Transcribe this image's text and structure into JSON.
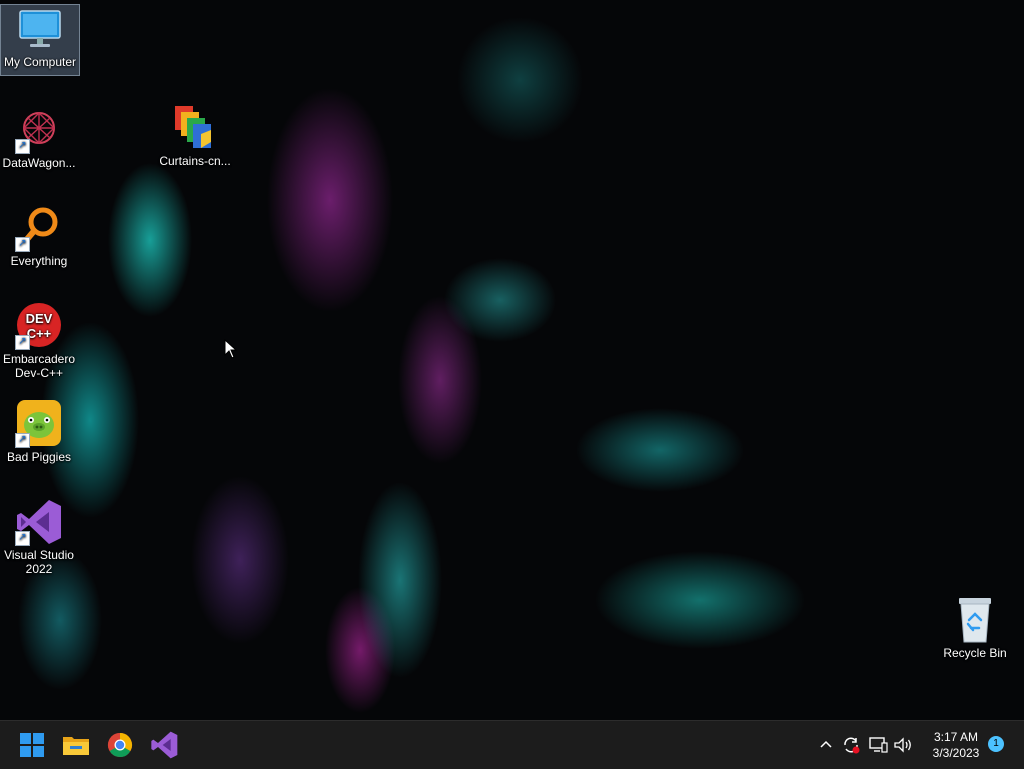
{
  "desktop": {
    "icons": [
      {
        "label": "My Computer",
        "icon": "monitor-icon"
      },
      {
        "label": "DataWagon...",
        "icon": "datawagon-icon"
      },
      {
        "label": "Curtains-cn...",
        "icon": "curtains-icon"
      },
      {
        "label": "Everything",
        "icon": "everything-search-icon"
      },
      {
        "label": "Embarcadero Dev-C++",
        "icon": "devcpp-icon",
        "badge_text": "DEV C++"
      },
      {
        "label": "Bad Piggies",
        "icon": "bad-piggies-icon"
      },
      {
        "label": "Visual Studio 2022",
        "icon": "visual-studio-icon"
      },
      {
        "label": "Recycle Bin",
        "icon": "recycle-bin-icon"
      }
    ]
  },
  "taskbar": {
    "pinned": [
      {
        "name": "Start",
        "icon": "windows-start-icon"
      },
      {
        "name": "File Explorer",
        "icon": "file-explorer-icon"
      },
      {
        "name": "Google Chrome",
        "icon": "chrome-icon"
      },
      {
        "name": "Visual Studio",
        "icon": "visual-studio-icon"
      }
    ],
    "tray": {
      "icons": [
        "chevron-up-icon",
        "sync-icon",
        "network-icon",
        "volume-icon"
      ],
      "time": "3:17 AM",
      "date": "3/3/2023",
      "notification_count": "1"
    }
  },
  "colors": {
    "taskbar": "#1c1c1c",
    "accent": "#4cc2ff",
    "windows_blue": "#2f9bf0"
  }
}
